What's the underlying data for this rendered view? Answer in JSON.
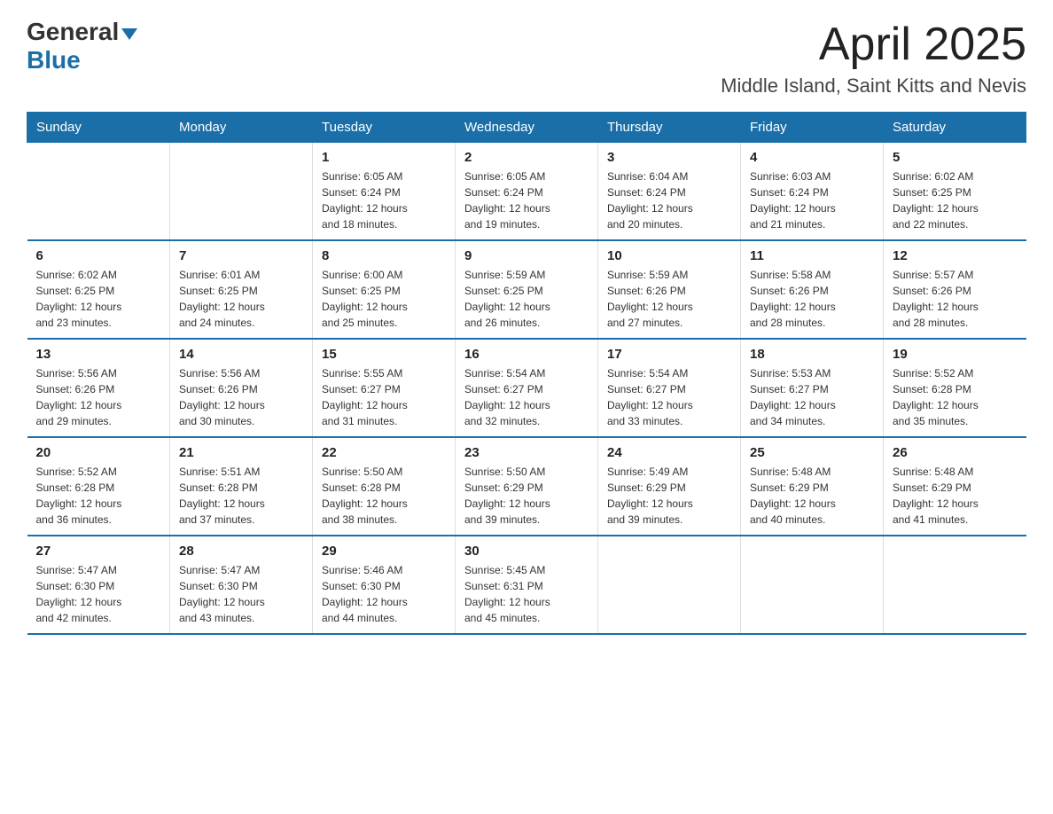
{
  "header": {
    "logo_general": "General",
    "logo_blue": "Blue",
    "month_title": "April 2025",
    "location": "Middle Island, Saint Kitts and Nevis"
  },
  "weekdays": [
    "Sunday",
    "Monday",
    "Tuesday",
    "Wednesday",
    "Thursday",
    "Friday",
    "Saturday"
  ],
  "weeks": [
    [
      {
        "day": "",
        "info": ""
      },
      {
        "day": "",
        "info": ""
      },
      {
        "day": "1",
        "info": "Sunrise: 6:05 AM\nSunset: 6:24 PM\nDaylight: 12 hours\nand 18 minutes."
      },
      {
        "day": "2",
        "info": "Sunrise: 6:05 AM\nSunset: 6:24 PM\nDaylight: 12 hours\nand 19 minutes."
      },
      {
        "day": "3",
        "info": "Sunrise: 6:04 AM\nSunset: 6:24 PM\nDaylight: 12 hours\nand 20 minutes."
      },
      {
        "day": "4",
        "info": "Sunrise: 6:03 AM\nSunset: 6:24 PM\nDaylight: 12 hours\nand 21 minutes."
      },
      {
        "day": "5",
        "info": "Sunrise: 6:02 AM\nSunset: 6:25 PM\nDaylight: 12 hours\nand 22 minutes."
      }
    ],
    [
      {
        "day": "6",
        "info": "Sunrise: 6:02 AM\nSunset: 6:25 PM\nDaylight: 12 hours\nand 23 minutes."
      },
      {
        "day": "7",
        "info": "Sunrise: 6:01 AM\nSunset: 6:25 PM\nDaylight: 12 hours\nand 24 minutes."
      },
      {
        "day": "8",
        "info": "Sunrise: 6:00 AM\nSunset: 6:25 PM\nDaylight: 12 hours\nand 25 minutes."
      },
      {
        "day": "9",
        "info": "Sunrise: 5:59 AM\nSunset: 6:25 PM\nDaylight: 12 hours\nand 26 minutes."
      },
      {
        "day": "10",
        "info": "Sunrise: 5:59 AM\nSunset: 6:26 PM\nDaylight: 12 hours\nand 27 minutes."
      },
      {
        "day": "11",
        "info": "Sunrise: 5:58 AM\nSunset: 6:26 PM\nDaylight: 12 hours\nand 28 minutes."
      },
      {
        "day": "12",
        "info": "Sunrise: 5:57 AM\nSunset: 6:26 PM\nDaylight: 12 hours\nand 28 minutes."
      }
    ],
    [
      {
        "day": "13",
        "info": "Sunrise: 5:56 AM\nSunset: 6:26 PM\nDaylight: 12 hours\nand 29 minutes."
      },
      {
        "day": "14",
        "info": "Sunrise: 5:56 AM\nSunset: 6:26 PM\nDaylight: 12 hours\nand 30 minutes."
      },
      {
        "day": "15",
        "info": "Sunrise: 5:55 AM\nSunset: 6:27 PM\nDaylight: 12 hours\nand 31 minutes."
      },
      {
        "day": "16",
        "info": "Sunrise: 5:54 AM\nSunset: 6:27 PM\nDaylight: 12 hours\nand 32 minutes."
      },
      {
        "day": "17",
        "info": "Sunrise: 5:54 AM\nSunset: 6:27 PM\nDaylight: 12 hours\nand 33 minutes."
      },
      {
        "day": "18",
        "info": "Sunrise: 5:53 AM\nSunset: 6:27 PM\nDaylight: 12 hours\nand 34 minutes."
      },
      {
        "day": "19",
        "info": "Sunrise: 5:52 AM\nSunset: 6:28 PM\nDaylight: 12 hours\nand 35 minutes."
      }
    ],
    [
      {
        "day": "20",
        "info": "Sunrise: 5:52 AM\nSunset: 6:28 PM\nDaylight: 12 hours\nand 36 minutes."
      },
      {
        "day": "21",
        "info": "Sunrise: 5:51 AM\nSunset: 6:28 PM\nDaylight: 12 hours\nand 37 minutes."
      },
      {
        "day": "22",
        "info": "Sunrise: 5:50 AM\nSunset: 6:28 PM\nDaylight: 12 hours\nand 38 minutes."
      },
      {
        "day": "23",
        "info": "Sunrise: 5:50 AM\nSunset: 6:29 PM\nDaylight: 12 hours\nand 39 minutes."
      },
      {
        "day": "24",
        "info": "Sunrise: 5:49 AM\nSunset: 6:29 PM\nDaylight: 12 hours\nand 39 minutes."
      },
      {
        "day": "25",
        "info": "Sunrise: 5:48 AM\nSunset: 6:29 PM\nDaylight: 12 hours\nand 40 minutes."
      },
      {
        "day": "26",
        "info": "Sunrise: 5:48 AM\nSunset: 6:29 PM\nDaylight: 12 hours\nand 41 minutes."
      }
    ],
    [
      {
        "day": "27",
        "info": "Sunrise: 5:47 AM\nSunset: 6:30 PM\nDaylight: 12 hours\nand 42 minutes."
      },
      {
        "day": "28",
        "info": "Sunrise: 5:47 AM\nSunset: 6:30 PM\nDaylight: 12 hours\nand 43 minutes."
      },
      {
        "day": "29",
        "info": "Sunrise: 5:46 AM\nSunset: 6:30 PM\nDaylight: 12 hours\nand 44 minutes."
      },
      {
        "day": "30",
        "info": "Sunrise: 5:45 AM\nSunset: 6:31 PM\nDaylight: 12 hours\nand 45 minutes."
      },
      {
        "day": "",
        "info": ""
      },
      {
        "day": "",
        "info": ""
      },
      {
        "day": "",
        "info": ""
      }
    ]
  ]
}
